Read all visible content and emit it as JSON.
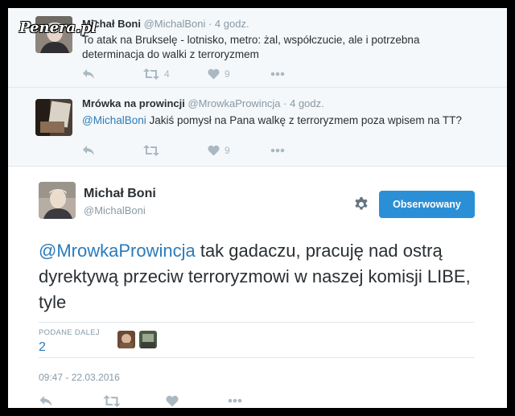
{
  "watermark": "Penera.pl",
  "replies": [
    {
      "name": "Michał Boni",
      "handle": "@MichalBoni",
      "time": "· 4 godz.",
      "text_line1": "To atak na Brukselę - lotnisko, metro: żal, współczucie, ale i potrzebna",
      "text_line2": "determinacja do walki z terroryzmem",
      "retweet_count": "4",
      "like_count": "9"
    },
    {
      "name": "Mrówka na prowincji",
      "handle": "@MrowkaProwincja",
      "time": "· 4 godz.",
      "mention": "@MichalBoni",
      "text": " Jakiś pomysł na Pana walkę z terroryzmem poza wpisem na TT?",
      "retweet_count": "",
      "like_count": "9"
    }
  ],
  "main_tweet": {
    "name": "Michał Boni",
    "handle": "@MichalBoni",
    "follow_label": "Obserwowany",
    "mention": "@MrowkaProwincja",
    "text": " tak gadaczu, pracuję nad ostrą dyrektywą przeciw terroryzmowi w naszej komisji LIBE, tyle",
    "retweets_label": "PODANE DALEJ",
    "retweets_value": "2",
    "timestamp": "09:47 - 22.03.2016"
  },
  "icons": {
    "reply": "reply-icon",
    "retweet": "retweet-icon",
    "like": "heart-icon",
    "more": "more-icon",
    "settings": "gear-icon"
  },
  "colors": {
    "link": "#2b7bb9",
    "follow_button": "#2b8fd6",
    "muted": "#8899a6",
    "icon": "#aab8c2"
  }
}
